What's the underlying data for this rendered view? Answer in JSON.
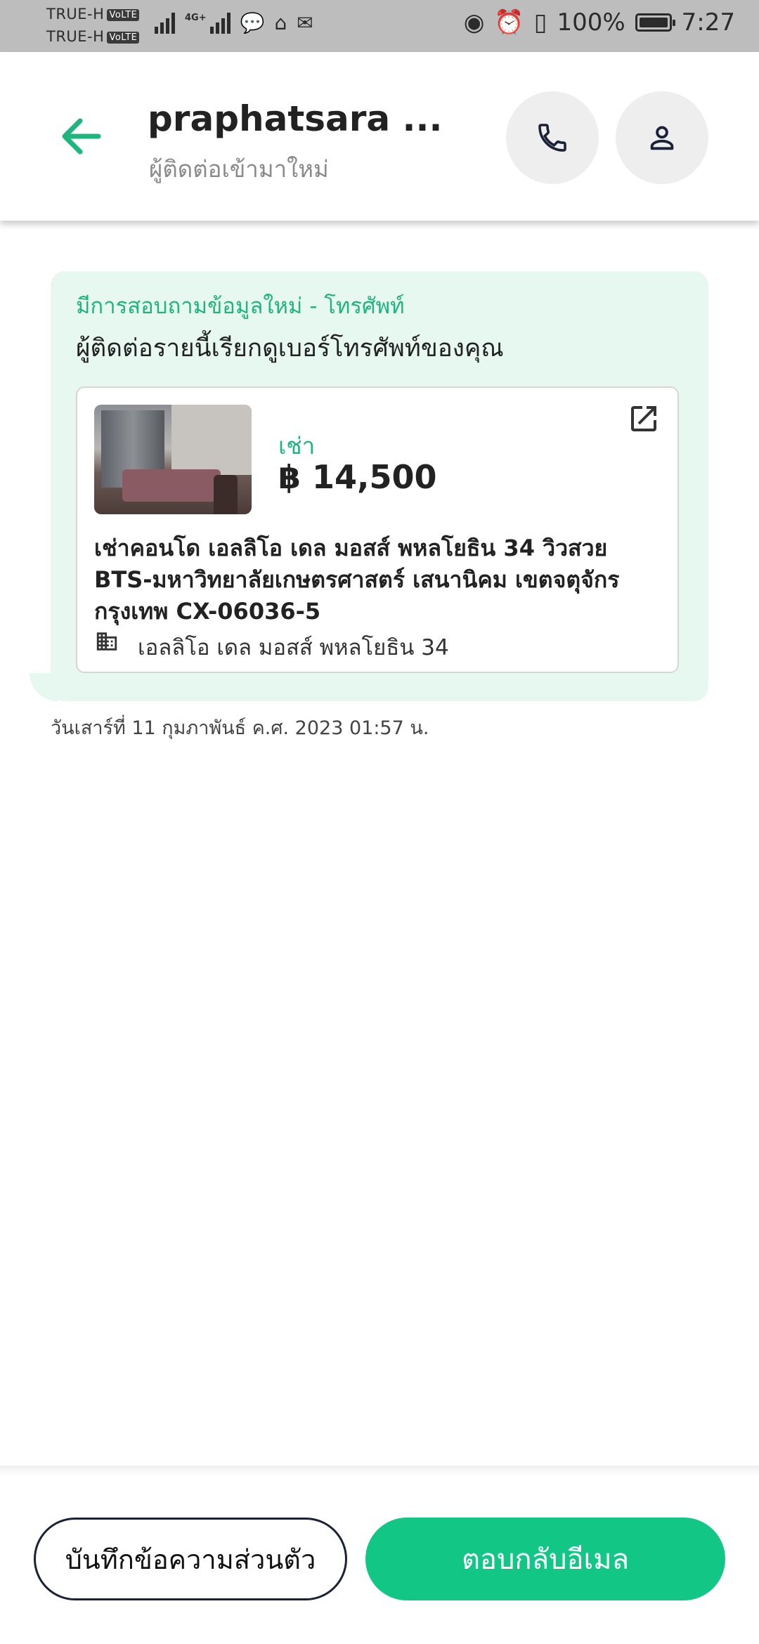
{
  "status_bar": {
    "carrier1": "TRUE-H",
    "carrier2": "TRUE-H",
    "volte": "VoLTE",
    "network": "4G+",
    "battery_percent": "100%",
    "time": "7:27"
  },
  "header": {
    "title": "praphatsara ...",
    "subtitle": "ผู้ติดต่อเข้ามาใหม่"
  },
  "message": {
    "title": "มีการสอบถามข้อมูลใหม่ - โทรศัพท์",
    "body": "ผู้ติดต่อรายนี้เรียกดูเบอร์โทรศัพท์ของคุณ",
    "listing": {
      "type_label": "เช่า",
      "price": "฿ 14,500",
      "title": "เช่าคอนโด  เอลลิโอ เดล มอสส์ พหลโยธิน 34 วิวสวย BTS-มหาวิทยาลัยเกษตรศาสตร์ เสนานิคม เขตจตุจักร กรุงเทพ CX-06036-5",
      "project": "เอลลิโอ เดล มอสส์ พหลโยธิน 34"
    },
    "timestamp": "วันเสาร์ที่ 11 กุมภาพันธ์ ค.ศ. 2023 01:57 น."
  },
  "actions": {
    "note_label": "บันทึกข้อความส่วนตัว",
    "reply_label": "ตอบกลับอีเมล"
  },
  "colors": {
    "accent": "#12c785",
    "accent_text": "#1fb57e",
    "bubble_bg": "#e7f8f1"
  }
}
